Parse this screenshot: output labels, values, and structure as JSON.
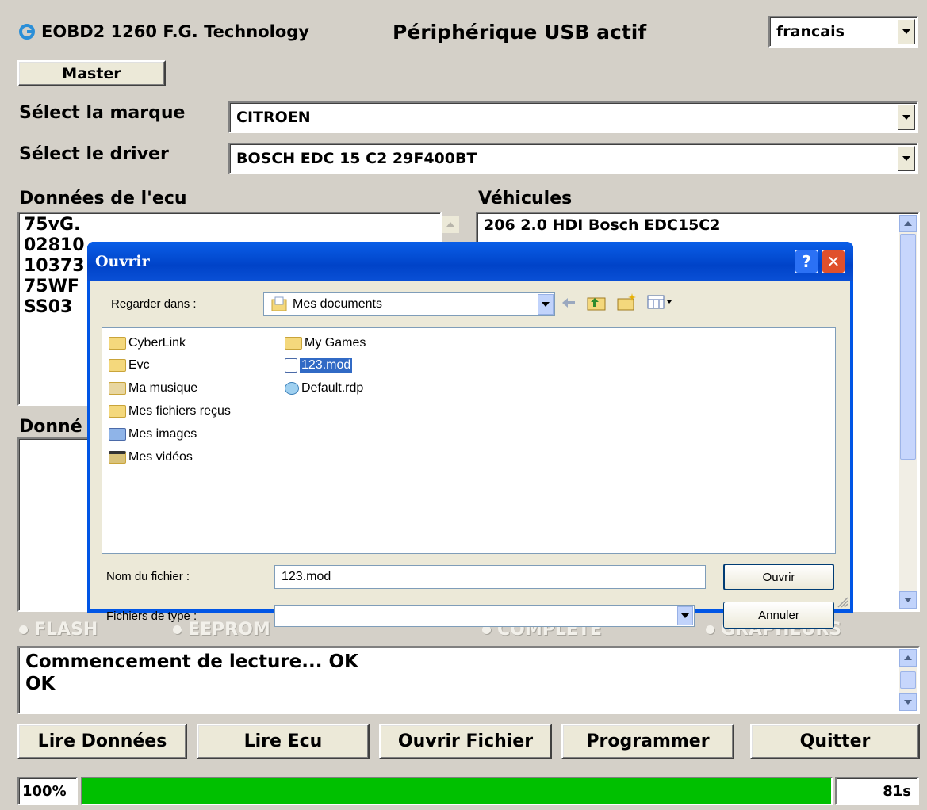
{
  "app": {
    "title": "EOBD2 1260 F.G. Technology",
    "usb_status": "Périphérique USB actif",
    "language": "francais",
    "master_label": "Master"
  },
  "brand": {
    "label": "Sélect la marque",
    "value": "CITROEN"
  },
  "driver": {
    "label": "Sélect le driver",
    "value": "BOSCH EDC 15 C2 29F400BT"
  },
  "ecu_data": {
    "label": "Données de l'ecu",
    "lines": [
      "75vG.",
      "02810",
      "10373",
      "75WF",
      "SS03"
    ]
  },
  "data2": {
    "label": "Donné"
  },
  "vehicles": {
    "label": "Véhicules",
    "items": [
      "206 2.0 HDI Bosch EDC15C2"
    ]
  },
  "options": {
    "flash": "FLASH",
    "eeprom": "EEPROM",
    "complete": "COMPLETE",
    "grapheurs": "GRAPHEURS"
  },
  "log": {
    "lines": [
      "Commencement de lecture... OK",
      "OK"
    ]
  },
  "buttons": {
    "read_data": "Lire Données",
    "read_ecu": "Lire Ecu",
    "open_file": "Ouvrir Fichier",
    "program": "Programmer",
    "quit": "Quitter"
  },
  "progress": {
    "percent_label": "100%",
    "fraction": 1.0,
    "time_label": "81s",
    "color": "#00c000"
  },
  "dialog": {
    "title": "Ouvrir",
    "help": "?",
    "close": "✕",
    "look_in_label": "Regarder dans :",
    "look_in_value": "Mes documents",
    "files_col1": [
      "CyberLink",
      "Evc",
      "Ma musique",
      "Mes fichiers reçus",
      "Mes images",
      "Mes vidéos"
    ],
    "files_col2": [
      "My Games",
      "123.mod",
      "Default.rdp"
    ],
    "selected": "123.mod",
    "filename_label": "Nom du fichier :",
    "filename_value": "123.mod",
    "filetype_label": "Fichiers de type :",
    "filetype_value": "",
    "open_label": "Ouvrir",
    "cancel_label": "Annuler"
  }
}
